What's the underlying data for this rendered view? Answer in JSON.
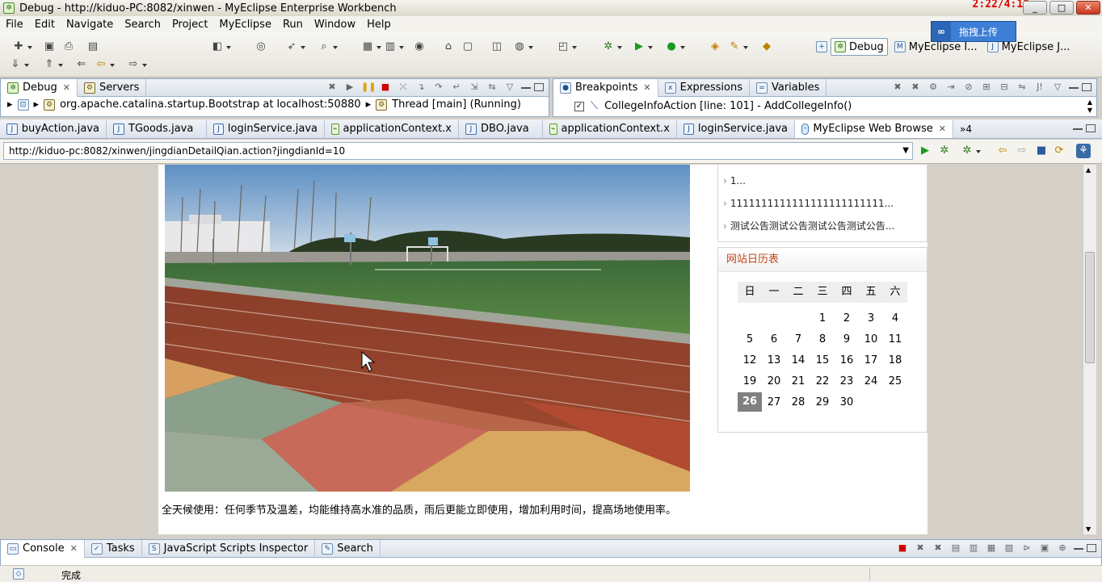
{
  "window": {
    "title": "Debug - http://kiduo-PC:8082/xinwen - MyEclipse Enterprise Workbench",
    "clock": "2:22/4:18"
  },
  "menu": [
    "File",
    "Edit",
    "Navigate",
    "Search",
    "Project",
    "MyEclipse",
    "Run",
    "Window",
    "Help"
  ],
  "upload": {
    "label": "拖拽上传"
  },
  "perspectives": {
    "active": "Debug",
    "others": [
      "MyEclipse I...",
      "MyEclipse J..."
    ]
  },
  "debug_view": {
    "tabs": [
      {
        "label": "Debug",
        "active": true
      },
      {
        "label": "Servers",
        "active": false
      }
    ],
    "tree_line": "org.apache.catalina.startup.Bootstrap at localhost:50880",
    "thread": "Thread [main] (Running)"
  },
  "bp_view": {
    "tabs": [
      {
        "label": "Breakpoints",
        "active": true
      },
      {
        "label": "Expressions",
        "active": false
      },
      {
        "label": "Variables",
        "active": false
      }
    ],
    "entry": "CollegeInfoAction [line: 101] - AddCollegeInfo()",
    "checked": true
  },
  "editor": {
    "tabs": [
      {
        "label": "buyAction.java",
        "type": "j"
      },
      {
        "label": "TGoods.java",
        "type": "j"
      },
      {
        "label": "loginService.java",
        "type": "j"
      },
      {
        "label": "applicationContext.x",
        "type": "xml"
      },
      {
        "label": "DBO.java",
        "type": "j"
      },
      {
        "label": "applicationContext.x",
        "type": "xml"
      },
      {
        "label": "loginService.java",
        "type": "j"
      },
      {
        "label": "MyEclipse Web Browse",
        "type": "globe",
        "active": true
      }
    ],
    "overflow": "»4"
  },
  "browser": {
    "url": "http://kiduo-pc:8082/xinwen/jingdianDetailQian.action?jingdianId=10"
  },
  "content": {
    "caption": "全天候使用：任何季节及温差，均能维持高水准的品质，雨后更能立即使用，增加利用时间，提高场地使用率。"
  },
  "sidebar": {
    "news": [
      "1...",
      "1111111111111111111111111...",
      "测试公告测试公告测试公告测试公告..."
    ]
  },
  "calendar": {
    "title": "网站日历表",
    "weekdays": [
      "日",
      "一",
      "二",
      "三",
      "四",
      "五",
      "六"
    ],
    "weeks": [
      [
        "",
        "",
        "",
        "1",
        "2",
        "3",
        "4"
      ],
      [
        "5",
        "6",
        "7",
        "8",
        "9",
        "10",
        "11"
      ],
      [
        "12",
        "13",
        "14",
        "15",
        "16",
        "17",
        "18"
      ],
      [
        "19",
        "20",
        "21",
        "22",
        "23",
        "24",
        "25"
      ],
      [
        "26",
        "27",
        "28",
        "29",
        "30",
        "",
        ""
      ]
    ],
    "today": "26"
  },
  "bottom": {
    "tabs": [
      {
        "label": "Console",
        "active": true
      },
      {
        "label": "Tasks"
      },
      {
        "label": "JavaScript Scripts Inspector"
      },
      {
        "label": "Search"
      }
    ]
  },
  "status": {
    "text": "完成"
  }
}
